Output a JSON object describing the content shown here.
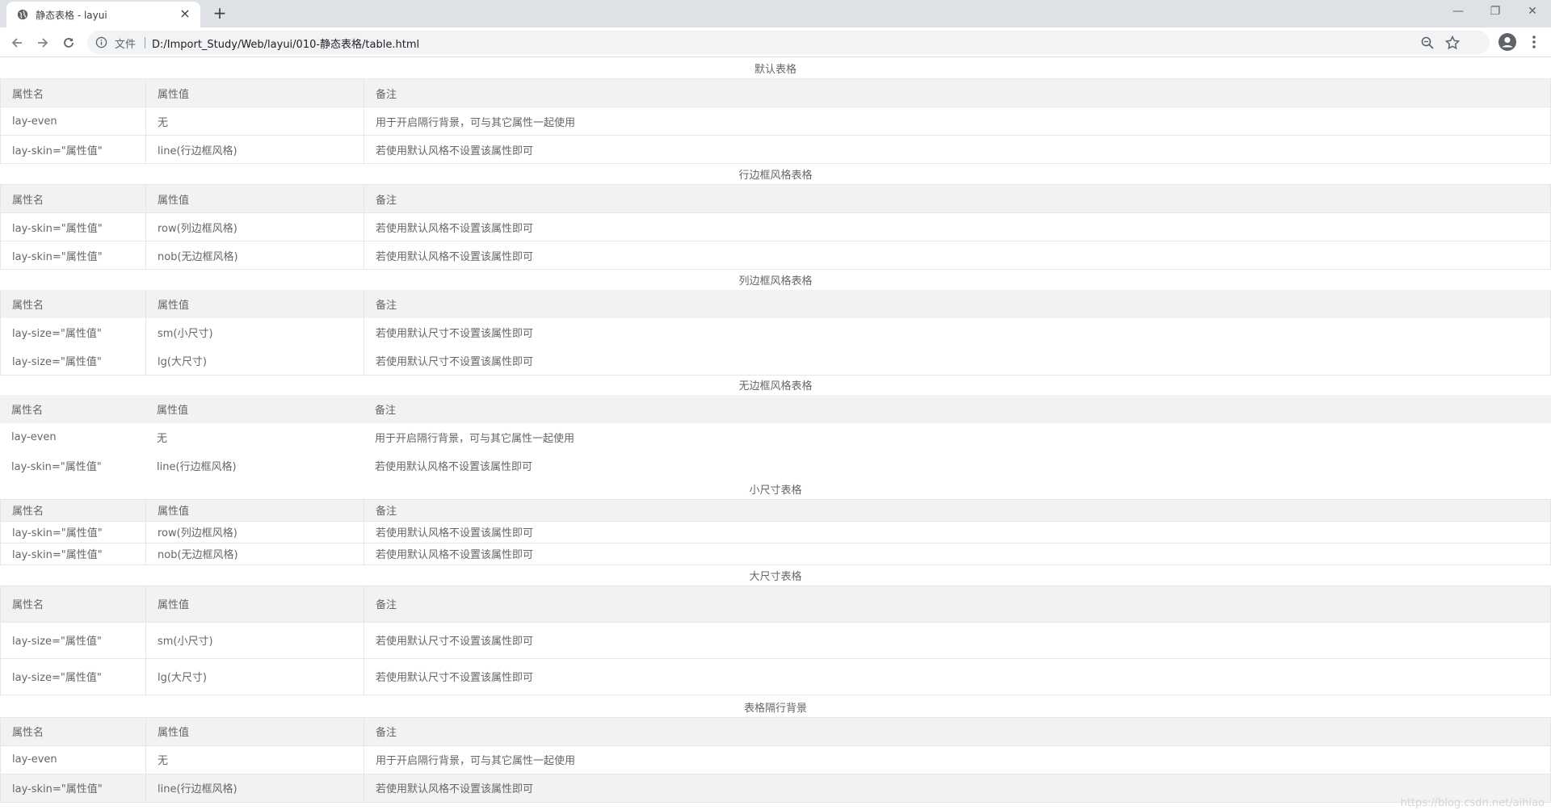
{
  "browser": {
    "tab_title": "静态表格 - layui",
    "tab_close": "×",
    "new_tab": "+",
    "win_min": "—",
    "win_max": "❐",
    "win_close": "✕",
    "scheme_label": "文件",
    "url": "D:/Import_Study/Web/layui/010-静态表格/table.html"
  },
  "tables": {
    "default": {
      "caption": "默认表格",
      "headers": [
        "属性名",
        "属性值",
        "备注"
      ],
      "rows": [
        [
          "lay-even",
          "无",
          "用于开启隔行背景，可与其它属性一起使用"
        ],
        [
          "lay-skin=\"属性值\"",
          "line(行边框风格)",
          "若使用默认风格不设置该属性即可"
        ]
      ]
    },
    "row": {
      "caption": "行边框风格表格",
      "headers": [
        "属性名",
        "属性值",
        "备注"
      ],
      "rows": [
        [
          "lay-skin=\"属性值\"",
          "row(列边框风格)",
          "若使用默认风格不设置该属性即可"
        ],
        [
          "lay-skin=\"属性值\"",
          "nob(无边框风格)",
          "若使用默认风格不设置该属性即可"
        ]
      ]
    },
    "col": {
      "caption": "列边框风格表格",
      "headers": [
        "属性名",
        "属性值",
        "备注"
      ],
      "rows": [
        [
          "lay-size=\"属性值\"",
          "sm(小尺寸)",
          "若使用默认尺寸不设置该属性即可"
        ],
        [
          "lay-size=\"属性值\"",
          "lg(大尺寸)",
          "若使用默认尺寸不设置该属性即可"
        ]
      ]
    },
    "nob": {
      "caption": "无边框风格表格",
      "headers": [
        "属性名",
        "属性值",
        "备注"
      ],
      "rows": [
        [
          "lay-even",
          "无",
          "用于开启隔行背景，可与其它属性一起使用"
        ],
        [
          "lay-skin=\"属性值\"",
          "line(行边框风格)",
          "若使用默认风格不设置该属性即可"
        ]
      ]
    },
    "sm": {
      "caption": "小尺寸表格",
      "headers": [
        "属性名",
        "属性值",
        "备注"
      ],
      "rows": [
        [
          "lay-skin=\"属性值\"",
          "row(列边框风格)",
          "若使用默认风格不设置该属性即可"
        ],
        [
          "lay-skin=\"属性值\"",
          "nob(无边框风格)",
          "若使用默认风格不设置该属性即可"
        ]
      ]
    },
    "lg": {
      "caption": "大尺寸表格",
      "headers": [
        "属性名",
        "属性值",
        "备注"
      ],
      "rows": [
        [
          "lay-size=\"属性值\"",
          "sm(小尺寸)",
          "若使用默认尺寸不设置该属性即可"
        ],
        [
          "lay-size=\"属性值\"",
          "lg(大尺寸)",
          "若使用默认尺寸不设置该属性即可"
        ]
      ]
    },
    "even": {
      "caption": "表格隔行背景",
      "headers": [
        "属性名",
        "属性值",
        "备注"
      ],
      "rows": [
        [
          "lay-even",
          "无",
          "用于开启隔行背景，可与其它属性一起使用"
        ],
        [
          "lay-skin=\"属性值\"",
          "line(行边框风格)",
          "若使用默认风格不设置该属性即可"
        ]
      ]
    }
  },
  "watermark": "https://blog.csdn.net/aihiao",
  "colors": {
    "header_bg": "#f2f2f2",
    "border": "#e6e6e6",
    "text": "#666666"
  }
}
